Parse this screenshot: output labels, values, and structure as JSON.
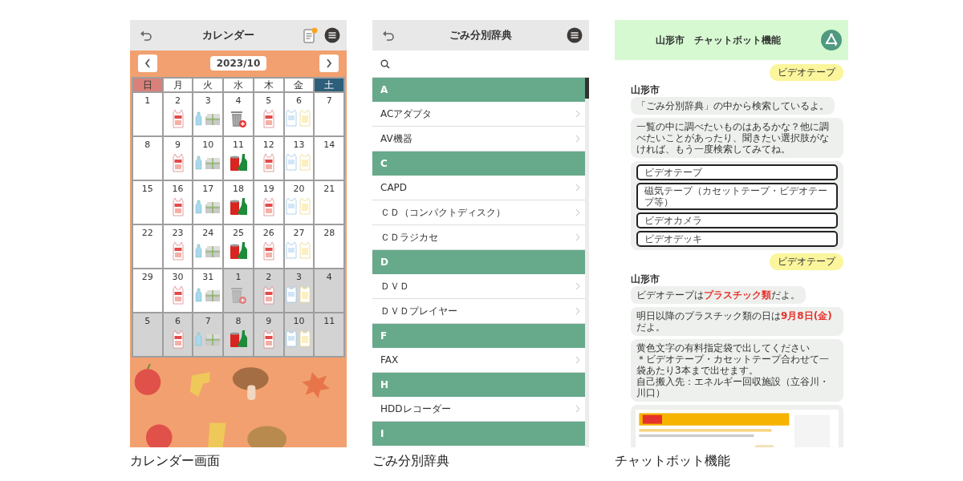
{
  "calendar": {
    "title": "カレンダー",
    "month": "2023/10",
    "caption": "カレンダー画面",
    "weekdays": [
      {
        "label": "日",
        "kind": "sun"
      },
      {
        "label": "月",
        "kind": "weekday"
      },
      {
        "label": "火",
        "kind": "weekday"
      },
      {
        "label": "水",
        "kind": "weekday"
      },
      {
        "label": "木",
        "kind": "weekday"
      },
      {
        "label": "金",
        "kind": "weekday"
      },
      {
        "label": "土",
        "kind": "sat"
      }
    ],
    "weeks": [
      [
        {
          "day": "1",
          "other_month": false,
          "kind": "none"
        },
        {
          "day": "2",
          "other_month": false,
          "kind": "burnable"
        },
        {
          "day": "3",
          "other_month": false,
          "kind": "bottles-paper"
        },
        {
          "day": "4",
          "other_month": false,
          "kind": "hazardous"
        },
        {
          "day": "5",
          "other_month": false,
          "kind": "burnable"
        },
        {
          "day": "6",
          "other_month": false,
          "kind": "plastic"
        },
        {
          "day": "7",
          "other_month": false,
          "kind": "none"
        }
      ],
      [
        {
          "day": "8",
          "other_month": false,
          "kind": "none"
        },
        {
          "day": "9",
          "other_month": false,
          "kind": "burnable"
        },
        {
          "day": "10",
          "other_month": false,
          "kind": "bottles-paper"
        },
        {
          "day": "11",
          "other_month": false,
          "kind": "cans-glass"
        },
        {
          "day": "12",
          "other_month": false,
          "kind": "burnable"
        },
        {
          "day": "13",
          "other_month": false,
          "kind": "plastic"
        },
        {
          "day": "14",
          "other_month": false,
          "kind": "none"
        }
      ],
      [
        {
          "day": "15",
          "other_month": false,
          "kind": "none"
        },
        {
          "day": "16",
          "other_month": false,
          "kind": "burnable"
        },
        {
          "day": "17",
          "other_month": false,
          "kind": "bottles-paper"
        },
        {
          "day": "18",
          "other_month": false,
          "kind": "cans-glass"
        },
        {
          "day": "19",
          "other_month": false,
          "kind": "burnable"
        },
        {
          "day": "20",
          "other_month": false,
          "kind": "plastic"
        },
        {
          "day": "21",
          "other_month": false,
          "kind": "none"
        }
      ],
      [
        {
          "day": "22",
          "other_month": false,
          "kind": "none"
        },
        {
          "day": "23",
          "other_month": false,
          "kind": "burnable"
        },
        {
          "day": "24",
          "other_month": false,
          "kind": "bottles-paper"
        },
        {
          "day": "25",
          "other_month": false,
          "kind": "cans-glass"
        },
        {
          "day": "26",
          "other_month": false,
          "kind": "burnable"
        },
        {
          "day": "27",
          "other_month": false,
          "kind": "plastic"
        },
        {
          "day": "28",
          "other_month": false,
          "kind": "none"
        }
      ],
      [
        {
          "day": "29",
          "other_month": false,
          "kind": "none"
        },
        {
          "day": "30",
          "other_month": false,
          "kind": "burnable"
        },
        {
          "day": "31",
          "other_month": false,
          "kind": "bottles-paper"
        },
        {
          "day": "1",
          "other_month": true,
          "kind": "hazardous"
        },
        {
          "day": "2",
          "other_month": true,
          "kind": "burnable"
        },
        {
          "day": "3",
          "other_month": true,
          "kind": "plastic"
        },
        {
          "day": "4",
          "other_month": true,
          "kind": "none"
        }
      ],
      [
        {
          "day": "5",
          "other_month": true,
          "kind": "none"
        },
        {
          "day": "6",
          "other_month": true,
          "kind": "burnable"
        },
        {
          "day": "7",
          "other_month": true,
          "kind": "bottles-paper"
        },
        {
          "day": "8",
          "other_month": true,
          "kind": "cans-glass"
        },
        {
          "day": "9",
          "other_month": true,
          "kind": "burnable"
        },
        {
          "day": "10",
          "other_month": true,
          "kind": "plastic"
        },
        {
          "day": "11",
          "other_month": true,
          "kind": "none"
        }
      ]
    ]
  },
  "dictionary": {
    "title": "ごみ分別辞典",
    "caption": "ごみ分別辞典",
    "sections": [
      {
        "letter": "A",
        "items": [
          {
            "label": "ACアダプタ"
          },
          {
            "label": "AV機器"
          }
        ]
      },
      {
        "letter": "C",
        "items": [
          {
            "label": "CAPD"
          },
          {
            "label": "ＣＤ（コンパクトディスク）"
          },
          {
            "label": "ＣＤラジカセ"
          }
        ]
      },
      {
        "letter": "D",
        "items": [
          {
            "label": "ＤＶＤ"
          },
          {
            "label": "ＤＶＤプレイヤー"
          }
        ]
      },
      {
        "letter": "F",
        "items": [
          {
            "label": "FAX"
          }
        ]
      },
      {
        "letter": "H",
        "items": [
          {
            "label": "HDDレコーダー"
          }
        ]
      },
      {
        "letter": "I"
      }
    ]
  },
  "chatbot": {
    "title": "山形市　チャットボット機能",
    "caption": "チャットボット機能",
    "messages": [
      {
        "kind": "user",
        "text": "ビデオテープ"
      },
      {
        "kind": "sender",
        "text": "山形市"
      },
      {
        "kind": "bot",
        "lines": [
          "「ごみ分別辞典」の中から検索しているよ。"
        ]
      },
      {
        "kind": "bot",
        "lines": [
          "一覧の中に調べたいものはあるかな？他に調べたいことがあったり、聞きたい選択肢がなければ、もう一度検索してみてね。"
        ]
      },
      {
        "kind": "choices",
        "options": [
          "ビデオテープ",
          "磁気テープ（カセットテープ・ビデオテープ等）",
          "ビデオカメラ",
          "ビデオデッキ"
        ]
      },
      {
        "kind": "user",
        "text": "ビデオテープ"
      },
      {
        "kind": "sender",
        "text": "山形市"
      },
      {
        "kind": "bot",
        "lines": [
          "ビデオテープは**プラスチック類**だよ。"
        ]
      },
      {
        "kind": "bot",
        "lines": [
          "明日以降のプラスチック類の日は**9月8日(金)**だよ。"
        ]
      },
      {
        "kind": "bot",
        "lines": [
          "黄色文字の有料指定袋で出してください",
          "＊ビデオテープ・カセットテープ合わせて一袋あたり3本まで出せます。",
          "自己搬入先：エネルギー回収施設（立谷川・川口）"
        ]
      },
      {
        "kind": "picture"
      }
    ]
  }
}
